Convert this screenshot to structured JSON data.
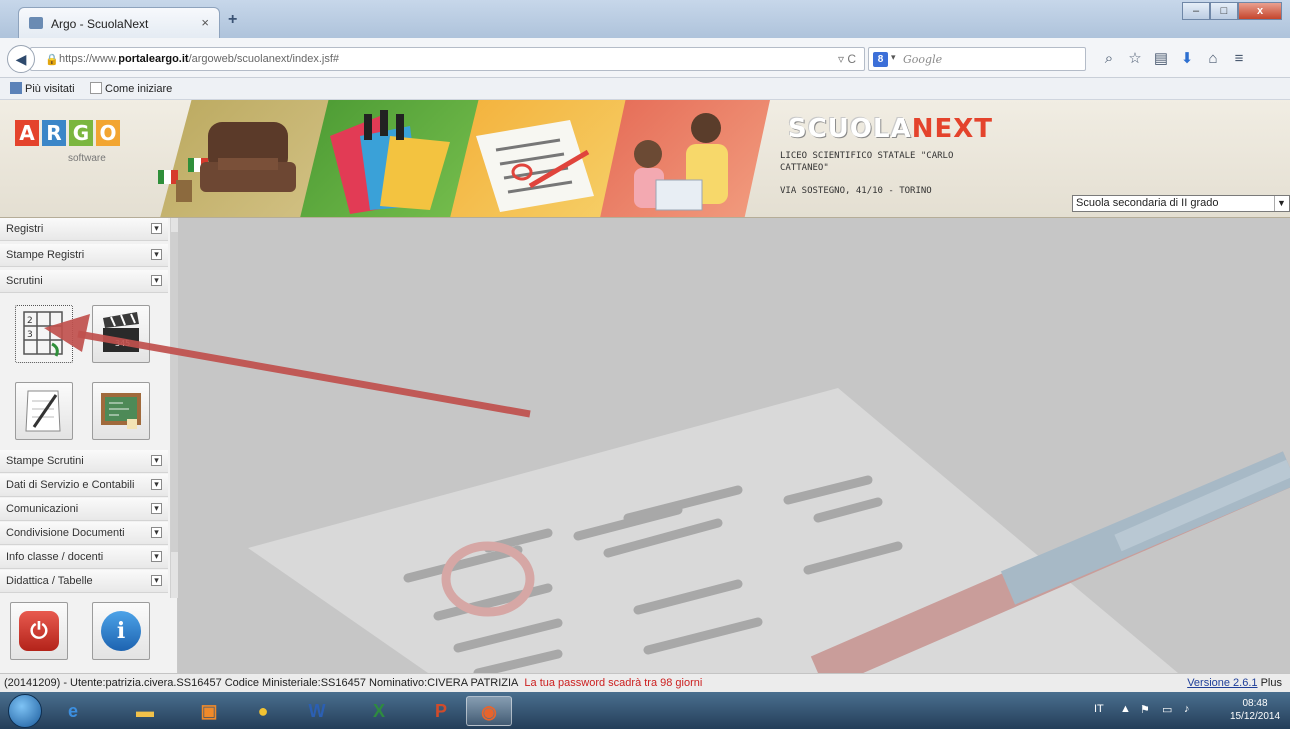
{
  "browser": {
    "tab_title": "Argo - ScuolaNext",
    "tab_close": "×",
    "new_tab": "+",
    "url_prefix": "https://www.",
    "url_domain": "portaleargo.it",
    "url_path": "/argoweb/scuolanext/index.jsf#",
    "search_placeholder": "Google",
    "search_engine_icon": "google-icon",
    "bookmarks": [
      "Più visitati",
      "Come iniziare"
    ]
  },
  "header": {
    "logo_letters": [
      "A",
      "R",
      "G",
      "O"
    ],
    "logo_colors": [
      "#e4432c",
      "#3b86c8",
      "#7bb63f",
      "#f2a531"
    ],
    "logo_sub": "software",
    "brand_part1": "SCUOLA",
    "brand_part2": "NEXT",
    "school_name": "LICEO SCIENTIFICO STATALE \"CARLO CATTANEO\"",
    "school_address": "VIA SOSTEGNO, 41/10 - TORINO",
    "school_type": "Scuola secondaria di II grado"
  },
  "sidebar": {
    "top_items": [
      "Registri",
      "Stampe Registri",
      "Scrutini"
    ],
    "bottom_items": [
      "Stampe Scrutini",
      "Dati di Servizio e Contabili",
      "Comunicazioni",
      "Condivisione Documenti",
      "Info classe / docenti",
      "Didattica / Tabelle"
    ],
    "toggle_glyph": "▾",
    "scrutini_tiles": [
      "grid-scores-icon",
      "clapperboard-icon",
      "pencil-paper-icon",
      "blackboard-icon"
    ],
    "exit_icon": "power-icon",
    "info_icon": "info-icon",
    "info_glyph": "i",
    "exit_glyph": "⏻"
  },
  "status": {
    "text": "(20141209) - Utente:patrizia.civera.SS16457 Codice Ministeriale:SS16457 Nominativo:CIVERA PATRIZIA",
    "warning": "La tua password scadrà tra 98 giorni",
    "version_link": "Versione 2.6.1",
    "version_suffix": " Plus"
  },
  "taskbar": {
    "tray_lang": "IT",
    "time": "08:48",
    "date": "15/12/2014"
  },
  "colors": {
    "arrow": "#c0504d",
    "brand_red": "#e4432c",
    "warning_red": "#cc2020"
  }
}
